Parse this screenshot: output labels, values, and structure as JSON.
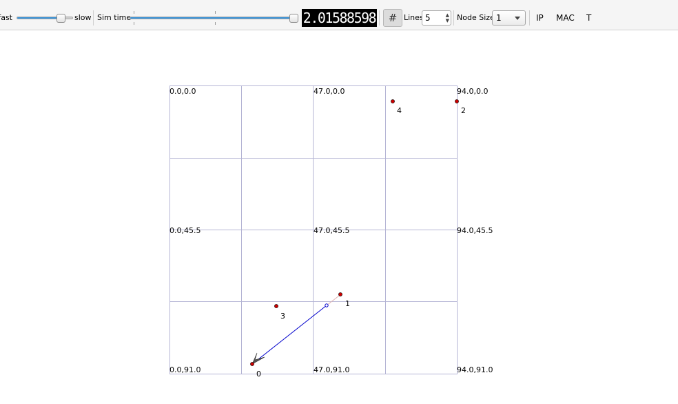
{
  "toolbar": {
    "fast_label": "fast",
    "slow_label": "slow",
    "speed_level": 0.82,
    "sim_time_label": "Sim time",
    "sim_time_level": 1.0,
    "sim_time_display": "2.01588598",
    "grid_icon": "grid-hash-icon",
    "lines_label": "Lines",
    "lines_value": "5",
    "node_size_label": "Node Size",
    "node_size_value": "1",
    "ip_button": "IP",
    "mac_button": "MAC",
    "t_button": "T"
  },
  "grid": {
    "corner_labels": {
      "top_left": "0.0,0.0",
      "top_mid": "47.0,0.0",
      "top_right": "94.0,0.0",
      "mid_left": "0.0,45.5",
      "mid_mid": "47.0,45.5",
      "mid_right": "94.0,45.5",
      "bot_left": "0.0,91.0",
      "bot_mid": "47.0,91.0",
      "bot_right": "94.0,91.0"
    },
    "line_color": "#b4b4d4"
  },
  "nodes": [
    {
      "id": "0",
      "label": "0"
    },
    {
      "id": "1",
      "label": "1"
    },
    {
      "id": "2",
      "label": "2"
    },
    {
      "id": "3",
      "label": "3"
    },
    {
      "id": "4",
      "label": "4"
    }
  ],
  "colors": {
    "node_fill": "#cc0000",
    "packet_line": "#0000cc",
    "slider_fill": "#3a93d8"
  }
}
